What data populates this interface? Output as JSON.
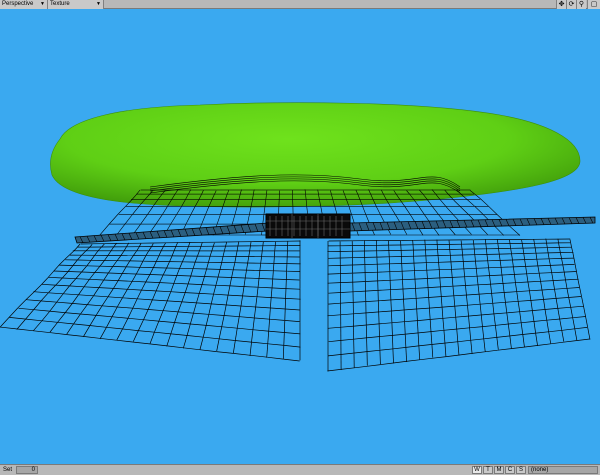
{
  "viewport_header": {
    "view_mode": "Perspective",
    "shading_mode": "Texture",
    "controls": [
      {
        "name": "move-view-icon",
        "glyph": "✥"
      },
      {
        "name": "rotate-view-icon",
        "glyph": "⟳"
      },
      {
        "name": "zoom-view-icon",
        "glyph": "⚲"
      },
      {
        "name": "maximize-view-icon",
        "glyph": "▢"
      }
    ]
  },
  "scene": {
    "background_color": "#3aa9f0",
    "island_color": "#5fcf15",
    "wire_color": "#000000"
  },
  "statusbar": {
    "set_label": "Set",
    "set_value": "0",
    "toggles": [
      "W",
      "T",
      "M",
      "C",
      "S"
    ],
    "layer_value": "(none)"
  }
}
